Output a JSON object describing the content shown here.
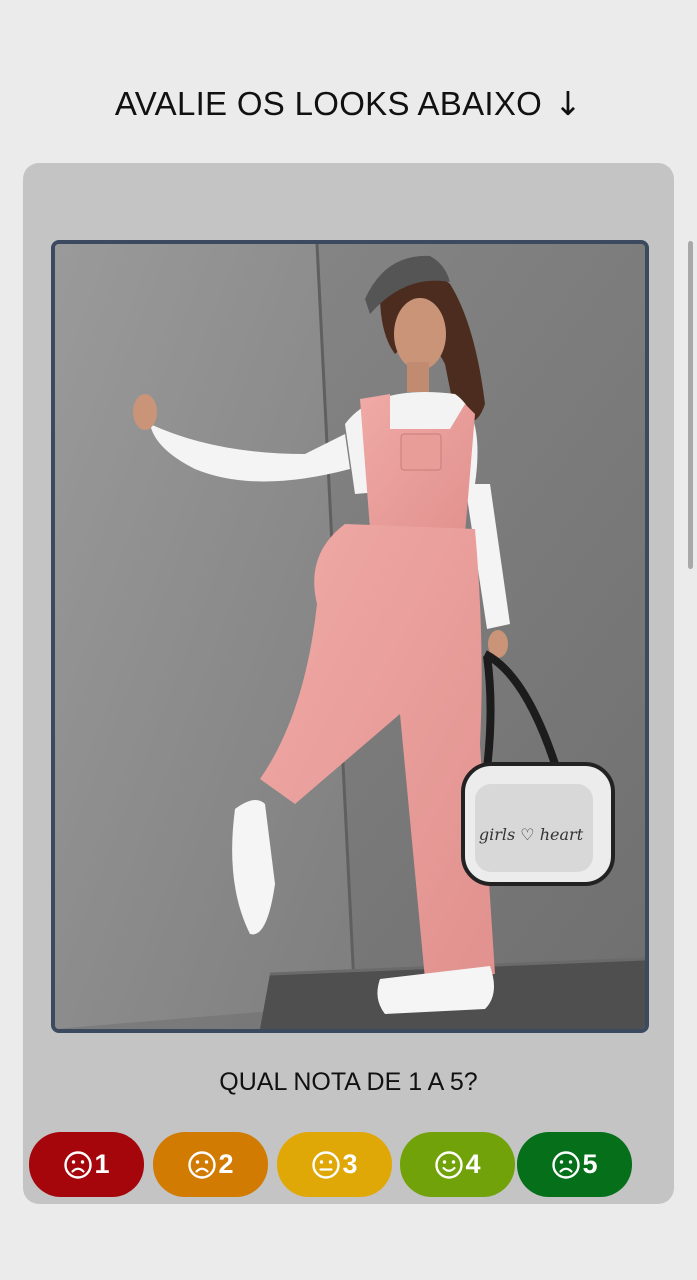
{
  "header": {
    "title": "AVALIE OS LOOKS ABAIXO",
    "arrow": "↓"
  },
  "look": {
    "bag_text": "girls ♡ heart"
  },
  "question": "QUAL NOTA DE 1 A 5?",
  "ratings": [
    {
      "value": "1",
      "face": "sad",
      "color": "#a4060c"
    },
    {
      "value": "2",
      "face": "sad",
      "color": "#d17b03"
    },
    {
      "value": "3",
      "face": "neutral",
      "color": "#dfa806"
    },
    {
      "value": "4",
      "face": "happy",
      "color": "#72a20a"
    },
    {
      "value": "5",
      "face": "sad",
      "color": "#056f19"
    }
  ]
}
